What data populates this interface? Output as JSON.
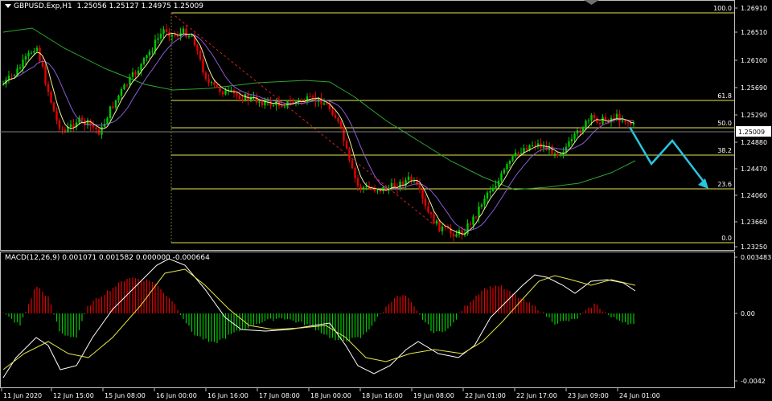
{
  "header": {
    "symbol": "GBPUSD.Exp,H1",
    "ohlc": "1.25056 1.25127 1.24975 1.25009"
  },
  "price_axis": {
    "labels": [
      "1.26910",
      "1.26510",
      "1.26100",
      "1.25690",
      "1.25290",
      "1.24880",
      "1.24470",
      "1.24060",
      "1.23660",
      "1.23250"
    ],
    "current_price": "1.25009"
  },
  "fibonacci": {
    "levels": [
      "100.0",
      "61.8",
      "50.0",
      "38.2",
      "23.6",
      "0.0"
    ],
    "color": "#e6e64c"
  },
  "macd": {
    "title": "MACD(12,26,9) 0.001071 0.001582 0.000000 -0.000664",
    "axis_labels": [
      "0.003483",
      "0.00",
      "-0.0042"
    ]
  },
  "time_axis": {
    "labels": [
      "11 Jun 2020",
      "12 Jun 15:00",
      "15 Jun 08:00",
      "16 Jun 00:00",
      "16 Jun 16:00",
      "17 Jun 08:00",
      "18 Jun 00:00",
      "18 Jun 16:00",
      "19 Jun 08:00",
      "22 Jun 01:00",
      "22 Jun 17:00",
      "23 Jun 09:00",
      "24 Jun 01:00"
    ]
  },
  "colors": {
    "bull": "#00c800",
    "bear": "#e60000",
    "ma_fast": "#f0f0a0",
    "ma_mid": "#8a5cd6",
    "ma_slow": "#2fa52f",
    "forecast_arrow": "#29c4e0",
    "macd_main": "#ffffff",
    "macd_signal": "#e6e64c"
  }
}
